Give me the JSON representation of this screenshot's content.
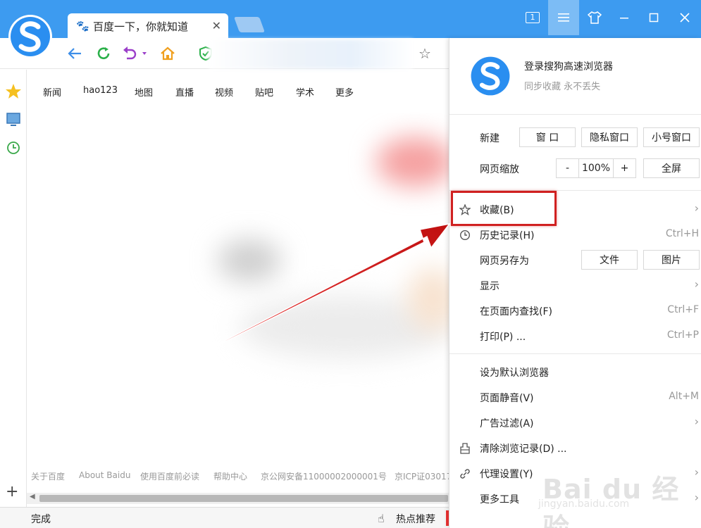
{
  "tab": {
    "title": "百度一下，你就知道"
  },
  "window": {
    "tab_count": "1"
  },
  "bookmarks": [
    "新闻",
    "hao123",
    "地图",
    "直播",
    "视频",
    "贴吧",
    "学术",
    "更多"
  ],
  "footer_links": [
    "关于百度",
    "About Baidu",
    "使用百度前必读",
    "帮助中心",
    "京公网安备11000002000001号",
    "京ICP证03017"
  ],
  "status": {
    "text": "完成",
    "hot": "热点推荐"
  },
  "menu": {
    "login_title": "登录搜狗高速浏览器",
    "login_sub": "同步收藏 永不丢失",
    "new_label": "新建",
    "new_buttons": [
      "窗 口",
      "隐私窗口",
      "小号窗口"
    ],
    "zoom_label": "网页缩放",
    "zoom_minus": "-",
    "zoom_value": "100%",
    "zoom_plus": "+",
    "fullscreen": "全屏",
    "favorites": "收藏(B)",
    "history": "历史记录(H)",
    "history_shortcut": "Ctrl+H",
    "save_as": "网页另存为",
    "save_file": "文件",
    "save_image": "图片",
    "display": "显示",
    "find": "在页面内查找(F)",
    "find_shortcut": "Ctrl+F",
    "print": "打印(P) ...",
    "print_shortcut": "Ctrl+P",
    "set_default": "设为默认浏览器",
    "mute": "页面静音(V)",
    "mute_shortcut": "Alt+M",
    "adblock": "广告过滤(A)",
    "clear_history": "清除浏览记录(D) ...",
    "proxy": "代理设置(Y)",
    "more_tools": "更多工具"
  },
  "watermark": {
    "brand": "Bai du 经验",
    "url": "jingyan.baidu.com"
  },
  "colors": {
    "titlebar": "#3d9bf0",
    "highlight": "#d02020",
    "logo": "#2a8ef0"
  }
}
